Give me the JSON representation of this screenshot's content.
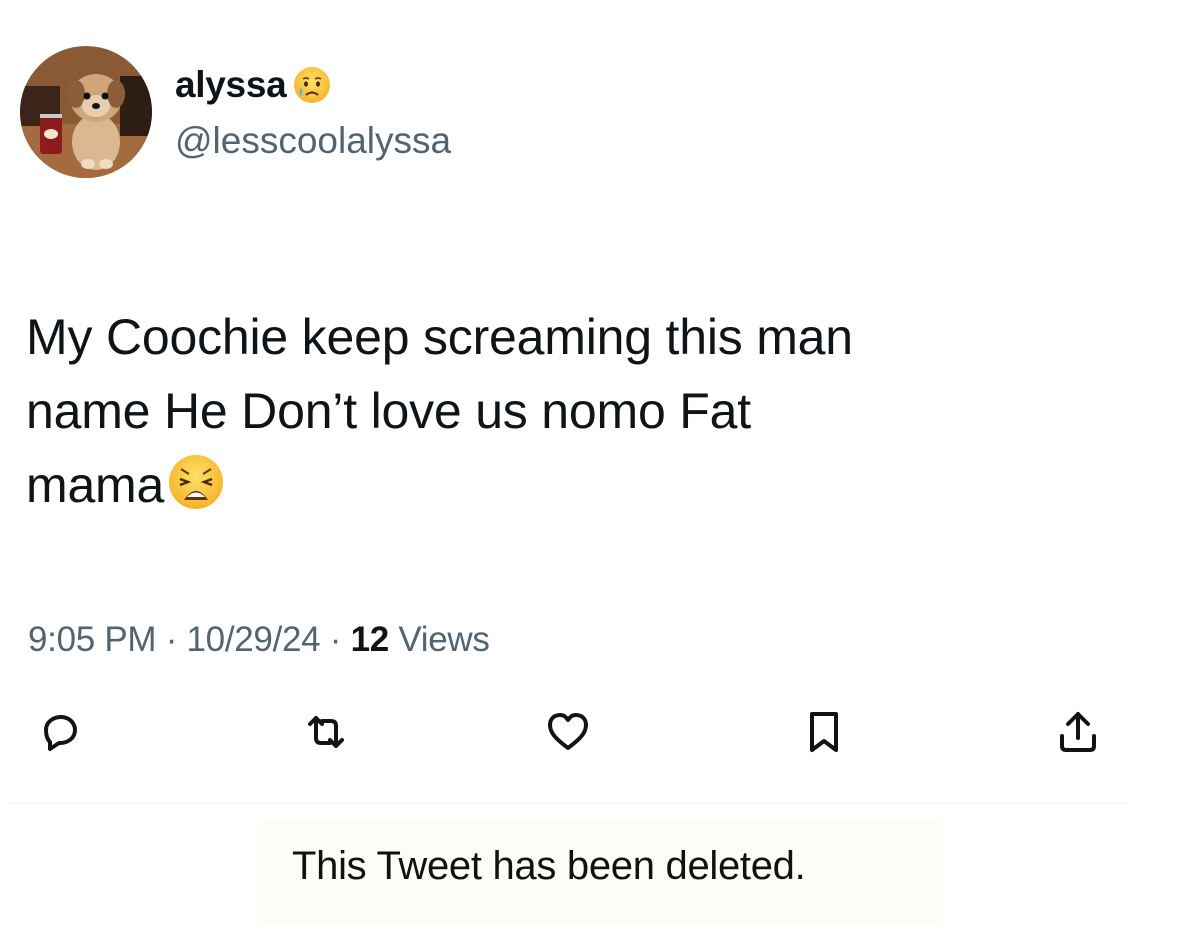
{
  "author": {
    "display_name": "alyssa",
    "name_emoji": "crying-face-emoji",
    "handle": "@lesscoolalyssa",
    "avatar": "puppy-avatar"
  },
  "tweet": {
    "line1": "My Coochie keep screaming this man",
    "line2": "name He Don’t love us nomo Fat",
    "line3": "mama",
    "trailing_emoji": "weary-face-emoji"
  },
  "meta": {
    "time": "9:05 PM",
    "separator": "·",
    "date": "10/29/24",
    "views_count": "12",
    "views_label": "Views"
  },
  "actions": {
    "reply_icon": "reply-icon",
    "retweet_icon": "retweet-icon",
    "like_icon": "heart-icon",
    "bookmark_icon": "bookmark-icon",
    "share_icon": "share-icon"
  },
  "notice": {
    "deleted_text": "This Tweet has been deleted."
  },
  "colors": {
    "primary_text": "#0f1419",
    "secondary_text": "#536471",
    "divider": "#eff3f4"
  }
}
